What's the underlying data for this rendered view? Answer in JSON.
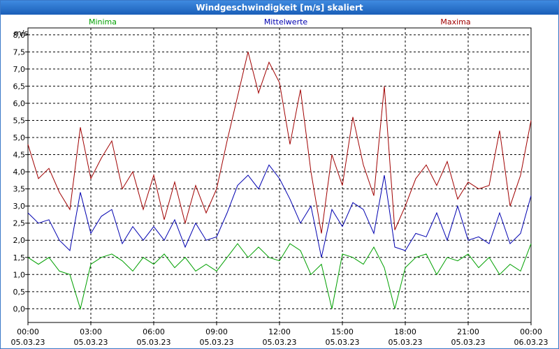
{
  "chart_data": {
    "type": "line",
    "title": "Windgeschwindigkeit [m/s] skaliert",
    "ylabel": "m/s",
    "ylim": [
      -0.4,
      8.2
    ],
    "y_ticks": [
      "0,0",
      "0,5",
      "1,0",
      "1,5",
      "2,0",
      "2,5",
      "3,0",
      "3,5",
      "4,0",
      "4,5",
      "5,0",
      "5,5",
      "6,0",
      "6,5",
      "7,0",
      "7,5",
      "8,0"
    ],
    "y_tick_values": [
      0,
      0.5,
      1,
      1.5,
      2,
      2.5,
      3,
      3.5,
      4,
      4.5,
      5,
      5.5,
      6,
      6.5,
      7,
      7.5,
      8
    ],
    "x_range_hours": [
      0,
      24
    ],
    "x_tick_times": [
      "00:00",
      "03:00",
      "06:00",
      "09:00",
      "12:00",
      "15:00",
      "18:00",
      "21:00",
      "00:00"
    ],
    "x_tick_dates": [
      "05.03.23",
      "05.03.23",
      "05.03.23",
      "05.03.23",
      "05.03.23",
      "05.03.23",
      "05.03.23",
      "05.03.23",
      "06.03.23"
    ],
    "grid": true,
    "x": [
      0,
      0.5,
      1,
      1.5,
      2,
      2.5,
      3,
      3.5,
      4,
      4.5,
      5,
      5.5,
      6,
      6.5,
      7,
      7.5,
      8,
      8.5,
      9,
      9.5,
      10,
      10.5,
      11,
      11.5,
      12,
      12.5,
      13,
      13.5,
      14,
      14.5,
      15,
      15.5,
      16,
      16.5,
      17,
      17.5,
      18,
      18.5,
      19,
      19.5,
      20,
      20.5,
      21,
      21.5,
      22,
      22.5,
      23,
      23.5,
      24
    ],
    "series": [
      {
        "name": "Minima",
        "color": "#00a000",
        "values": [
          1.5,
          1.3,
          1.5,
          1.1,
          1.0,
          0.0,
          1.3,
          1.5,
          1.6,
          1.4,
          1.1,
          1.5,
          1.3,
          1.6,
          1.2,
          1.5,
          1.1,
          1.3,
          1.1,
          1.5,
          1.9,
          1.5,
          1.8,
          1.5,
          1.4,
          1.9,
          1.7,
          1.0,
          1.3,
          0.0,
          1.6,
          1.5,
          1.3,
          1.8,
          1.2,
          0.0,
          1.2,
          1.5,
          1.6,
          1.0,
          1.5,
          1.4,
          1.6,
          1.2,
          1.5,
          1.0,
          1.3,
          1.1,
          1.9
        ]
      },
      {
        "name": "Mittelwerte",
        "color": "#0000b0",
        "values": [
          2.8,
          2.5,
          2.6,
          2.0,
          1.7,
          3.4,
          2.2,
          2.7,
          2.9,
          1.9,
          2.4,
          2.0,
          2.4,
          2.0,
          2.6,
          1.8,
          2.5,
          2.0,
          2.1,
          2.8,
          3.6,
          3.9,
          3.5,
          4.2,
          3.8,
          3.2,
          2.5,
          3.0,
          1.5,
          2.9,
          2.4,
          3.1,
          2.9,
          2.2,
          3.9,
          1.8,
          1.7,
          2.2,
          2.1,
          2.8,
          2.0,
          3.0,
          2.0,
          2.1,
          1.9,
          2.8,
          1.9,
          2.2,
          3.3
        ]
      },
      {
        "name": "Maxima",
        "color": "#a00000",
        "values": [
          4.8,
          3.8,
          4.1,
          3.4,
          2.9,
          5.3,
          3.8,
          4.4,
          4.9,
          3.5,
          4.0,
          2.9,
          3.9,
          2.6,
          3.7,
          2.5,
          3.6,
          2.8,
          3.5,
          4.9,
          6.2,
          7.5,
          6.3,
          7.2,
          6.6,
          4.8,
          6.4,
          4.0,
          2.2,
          4.5,
          3.6,
          5.6,
          4.2,
          3.3,
          6.5,
          2.3,
          3.0,
          3.8,
          4.2,
          3.6,
          4.3,
          3.2,
          3.7,
          3.5,
          3.6,
          5.2,
          3.0,
          3.9,
          5.5
        ]
      }
    ]
  }
}
